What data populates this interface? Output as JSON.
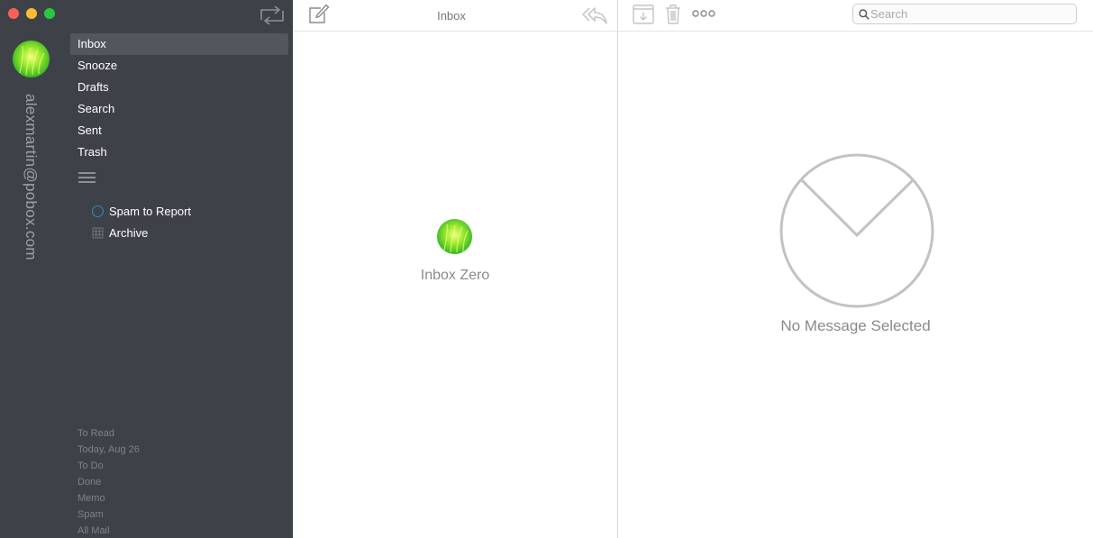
{
  "sidebar": {
    "account_email": "alexmartin@pobox.com",
    "nav_items": [
      {
        "label": "Inbox",
        "active": true
      },
      {
        "label": "Snooze",
        "active": false
      },
      {
        "label": "Drafts",
        "active": false
      },
      {
        "label": "Search",
        "active": false
      },
      {
        "label": "Sent",
        "active": false
      },
      {
        "label": "Trash",
        "active": false
      }
    ],
    "folders": [
      {
        "label": "Spam to Report",
        "icon": "circle-icon"
      },
      {
        "label": "Archive",
        "icon": "grid-icon"
      }
    ],
    "bottom_items": [
      "To Read",
      "Today, Aug 26",
      "To Do",
      "Done",
      "Memo",
      "Spam",
      "All Mail"
    ]
  },
  "list_pane": {
    "title": "Inbox",
    "empty_label": "Inbox Zero"
  },
  "reading_pane": {
    "search_placeholder": "Search",
    "empty_label": "No Message Selected"
  },
  "colors": {
    "sidebar_bg": "#3e4148",
    "active_item_bg": "#52565d",
    "accent_blue": "#2b8fc6",
    "avatar_green": "#3dbb24"
  }
}
